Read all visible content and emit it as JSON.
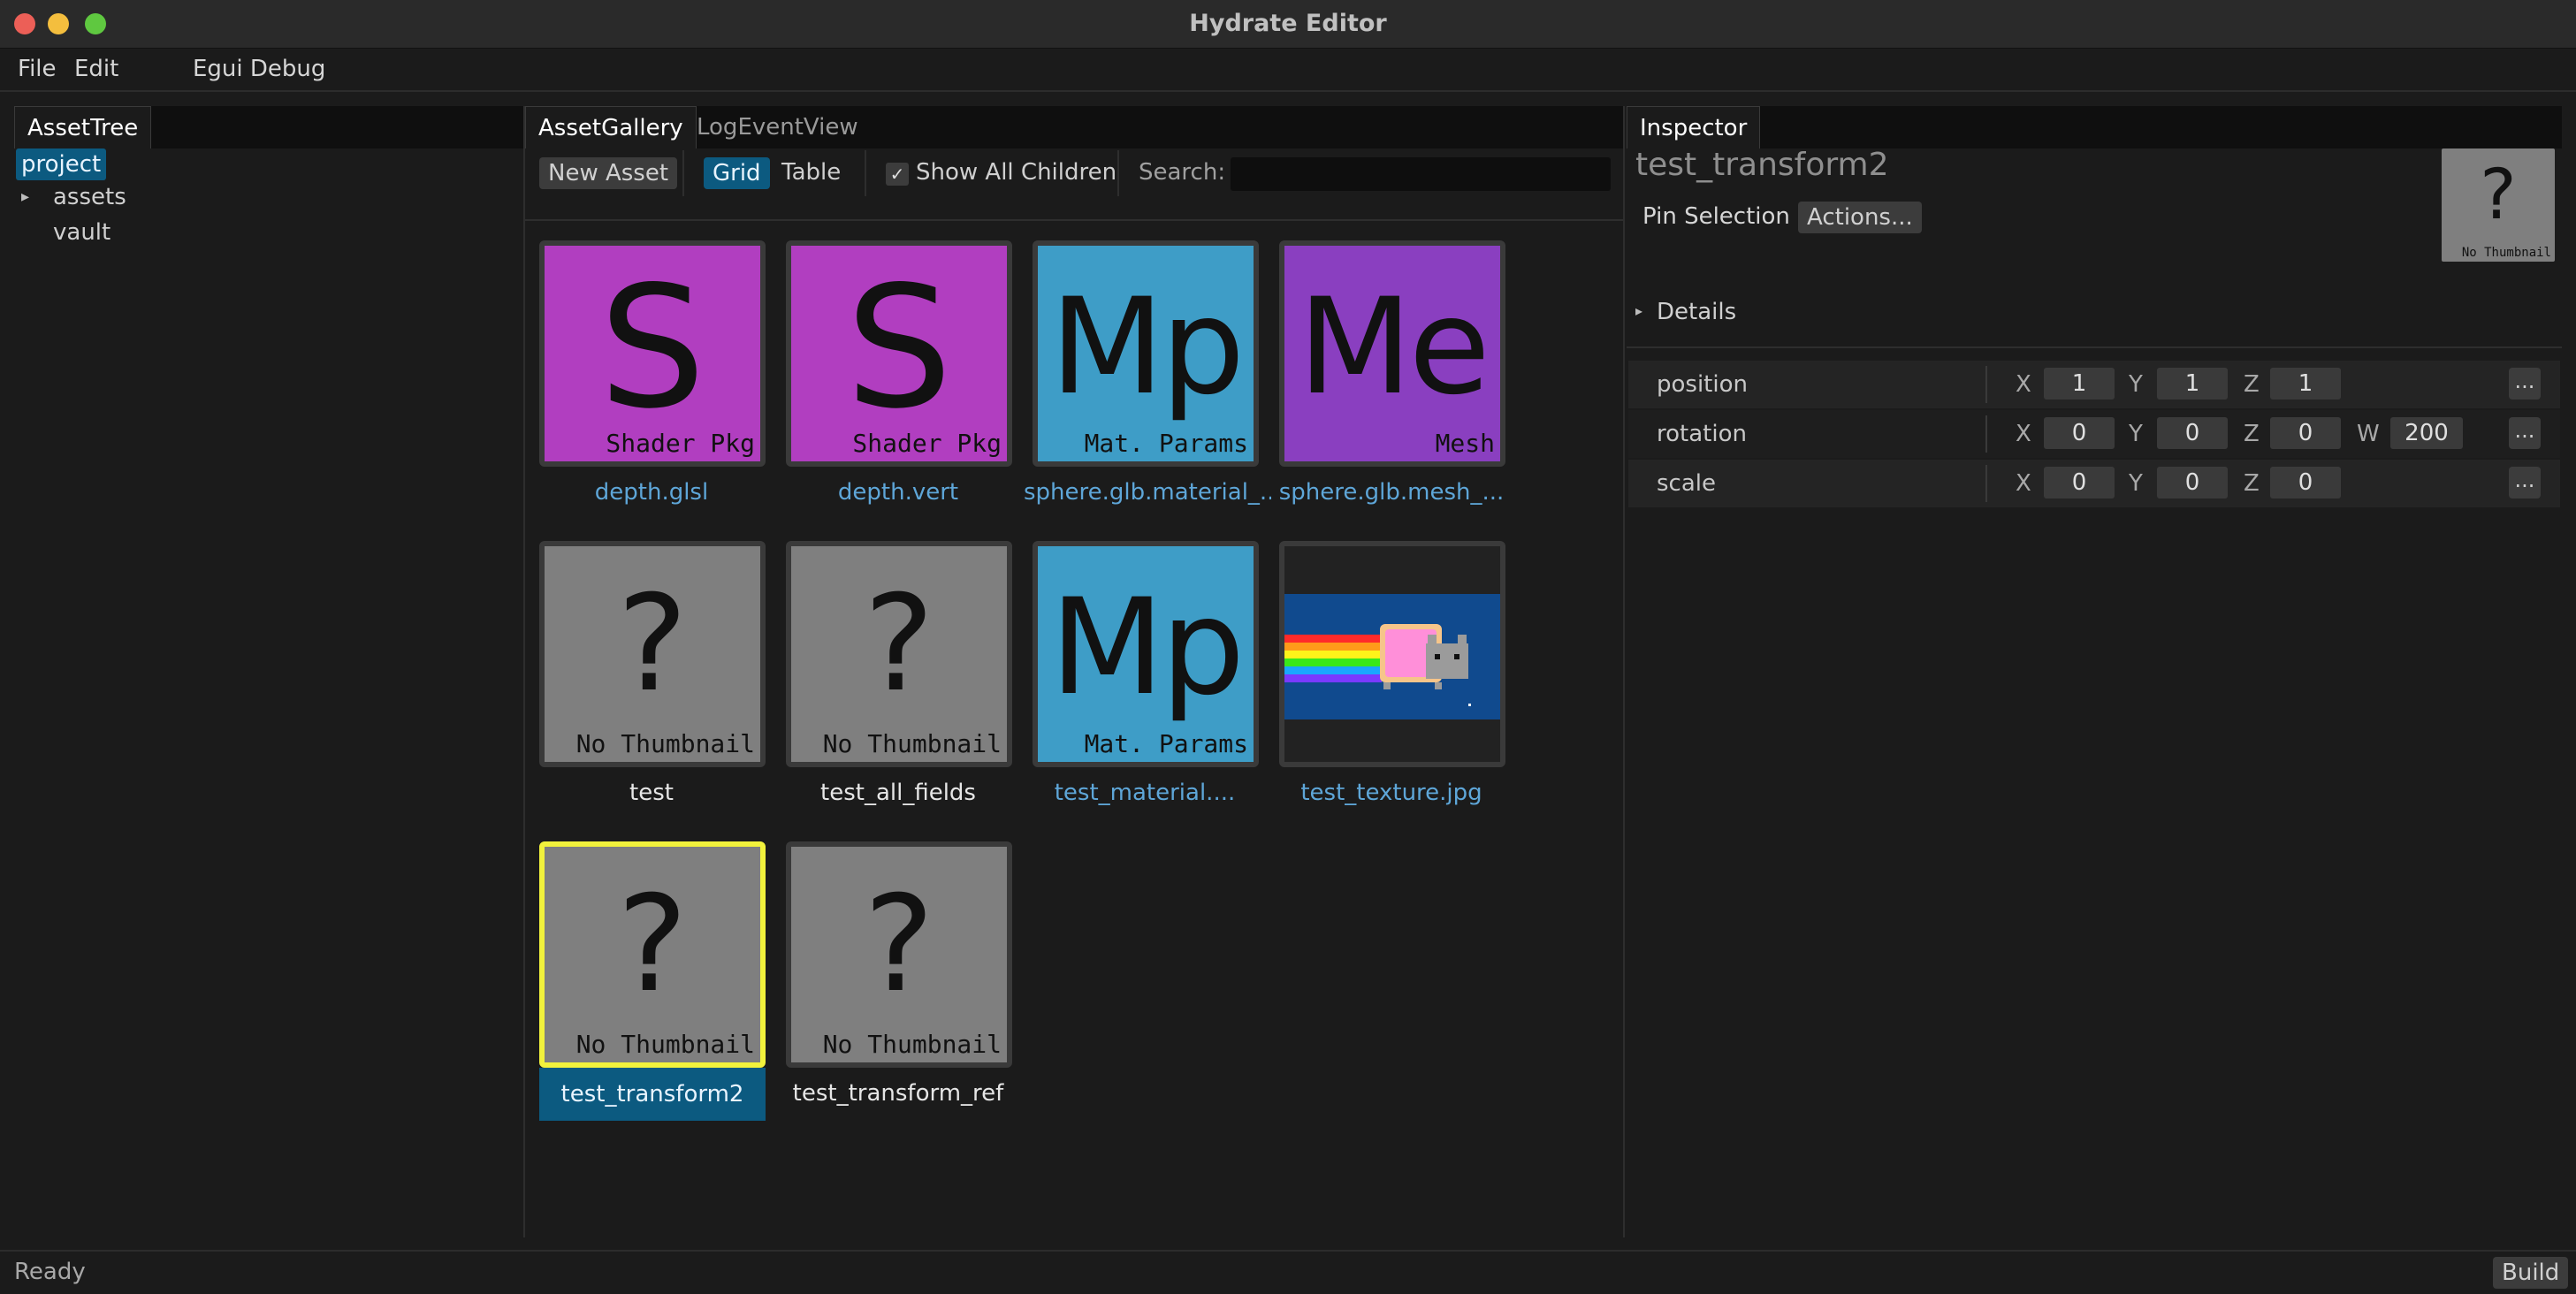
{
  "window": {
    "title": "Hydrate Editor",
    "traffic_lights": [
      "#ec5f57",
      "#f4be3e",
      "#5fc840"
    ]
  },
  "menu": [
    "File",
    "Edit",
    "Egui Debug"
  ],
  "left_panel": {
    "tab": "AssetTree",
    "tree": [
      {
        "label": "project",
        "selected": true
      },
      {
        "label": "assets",
        "expander": "▸"
      },
      {
        "label": "vault"
      }
    ]
  },
  "center_panel": {
    "tabs": [
      "AssetGallery",
      "LogEventView"
    ],
    "toolbar": {
      "new_asset": "New Asset",
      "grid": "Grid",
      "table": "Table",
      "show_all_children": "Show All Children",
      "checkmark": "✓",
      "search_label": "Search:",
      "search_value": ""
    },
    "assets": [
      {
        "name": "depth.glsl",
        "glyph": "S",
        "subtitle": "Shader Pkg",
        "bg": "#b13ec0",
        "link": true
      },
      {
        "name": "depth.vert",
        "glyph": "S",
        "subtitle": "Shader Pkg",
        "bg": "#b13ec0",
        "link": true
      },
      {
        "name": "sphere.glb.material_...",
        "glyph": "Mp",
        "subtitle": "Mat. Params",
        "bg": "#3e9dc7",
        "link": true
      },
      {
        "name": "sphere.glb.mesh_...",
        "glyph": "Me",
        "subtitle": "Mesh",
        "bg": "#8a3fc0",
        "link": true
      },
      {
        "name": "test",
        "glyph": "?",
        "subtitle": "No Thumbnail",
        "bg": "#7f7f7f",
        "link": false
      },
      {
        "name": "test_all_fields",
        "glyph": "?",
        "subtitle": "No Thumbnail",
        "bg": "#7f7f7f",
        "link": false
      },
      {
        "name": "test_material....",
        "glyph": "Mp",
        "subtitle": "Mat. Params",
        "bg": "#3e9dc7",
        "link": true
      },
      {
        "name": "test_texture.jpg",
        "glyph": "",
        "subtitle": "",
        "bg": "#222222",
        "link": true,
        "image": "nyan-cat"
      },
      {
        "name": "test_transform2",
        "glyph": "?",
        "subtitle": "No Thumbnail",
        "bg": "#7f7f7f",
        "link": false,
        "selected": true
      },
      {
        "name": "test_transform_ref",
        "glyph": "?",
        "subtitle": "No Thumbnail",
        "bg": "#7f7f7f",
        "link": false
      }
    ]
  },
  "inspector": {
    "tab": "Inspector",
    "asset_name": "test_transform2",
    "pin_selection": "Pin Selection",
    "actions": "Actions...",
    "thumb_glyph": "?",
    "thumb_label": "No Thumbnail",
    "details": "Details",
    "details_expander": "▸",
    "properties": [
      {
        "name": "position",
        "fields": [
          {
            "axis": "X",
            "value": "1"
          },
          {
            "axis": "Y",
            "value": "1"
          },
          {
            "axis": "Z",
            "value": "1"
          }
        ]
      },
      {
        "name": "rotation",
        "fields": [
          {
            "axis": "X",
            "value": "0"
          },
          {
            "axis": "Y",
            "value": "0"
          },
          {
            "axis": "Z",
            "value": "0"
          },
          {
            "axis": "W",
            "value": "200"
          }
        ]
      },
      {
        "name": "scale",
        "fields": [
          {
            "axis": "X",
            "value": "0"
          },
          {
            "axis": "Y",
            "value": "0"
          },
          {
            "axis": "Z",
            "value": "0"
          }
        ]
      }
    ],
    "more_button": "..."
  },
  "status": {
    "text": "Ready",
    "build": "Build"
  },
  "colors": {
    "accent": "#0c5a80",
    "link": "#5ea6d8",
    "selection_border": "#f2f23c"
  }
}
